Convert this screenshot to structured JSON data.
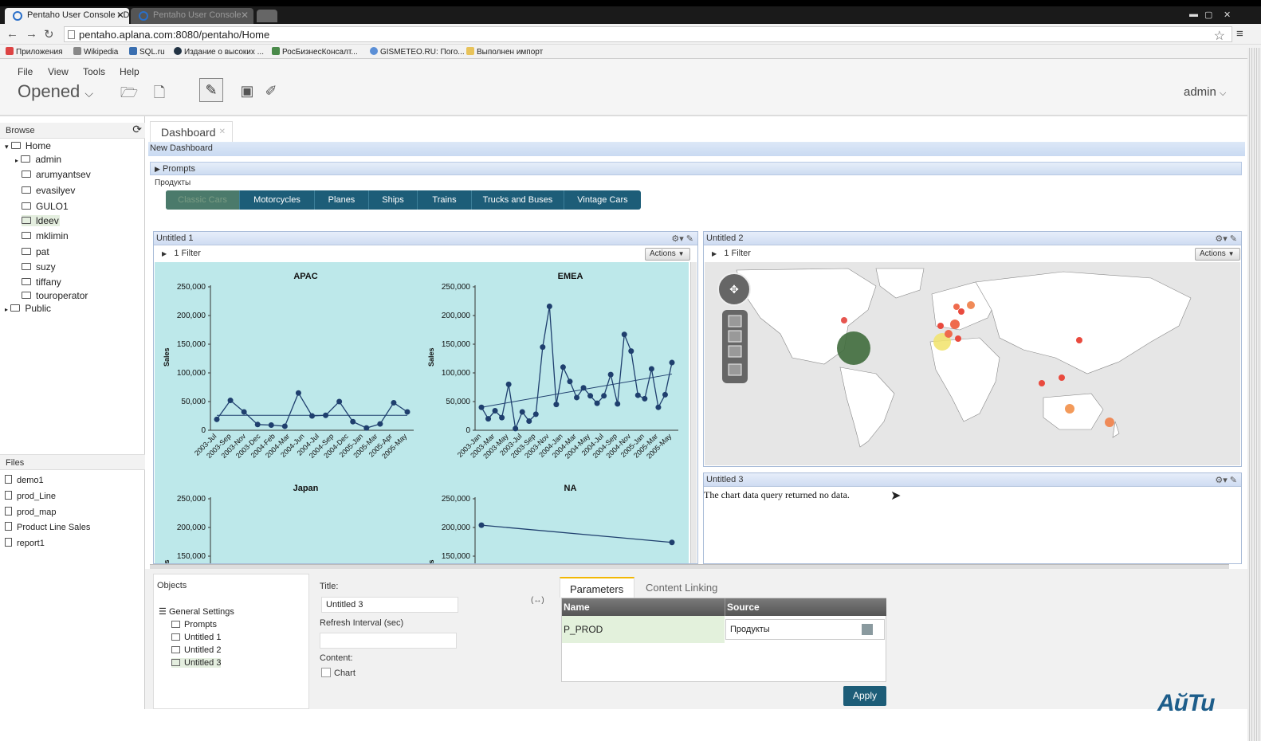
{
  "browser": {
    "tabs": [
      "Pentaho User Console - D",
      "Pentaho User Console"
    ],
    "url": "pentaho.aplana.com:8080/pentaho/Home",
    "bookmarks": [
      "Приложения",
      "Wikipedia",
      "SQL.ru",
      "Издание о высоких ...",
      "РосБизнесКонсалт...",
      "GISMETEO.RU: Пого...",
      "Выполнен импорт"
    ]
  },
  "app": {
    "menu": [
      "File",
      "View",
      "Tools",
      "Help"
    ],
    "perspective": "Opened",
    "user": "admin"
  },
  "browse": {
    "title": "Browse",
    "tree": [
      {
        "label": "Home"
      },
      {
        "label": "admin"
      },
      {
        "label": "arumyantsev"
      },
      {
        "label": "evasilyev"
      },
      {
        "label": "GULO1"
      },
      {
        "label": "ldeev"
      },
      {
        "label": "mklimin"
      },
      {
        "label": "pat"
      },
      {
        "label": "suzy"
      },
      {
        "label": "tiffany"
      },
      {
        "label": "touroperator"
      },
      {
        "label": "Public"
      }
    ]
  },
  "files": {
    "title": "Files",
    "items": [
      "demo1",
      "prod_Line",
      "prod_map",
      "Product Line Sales",
      "report1"
    ]
  },
  "dashboard": {
    "tab": "Dashboard",
    "name": "New Dashboard",
    "prompts_label": "Prompts",
    "prompt_name": "Продукты",
    "products": [
      "Classic Cars",
      "Motorcycles",
      "Planes",
      "Ships",
      "Trains",
      "Trucks and Buses",
      "Vintage Cars"
    ],
    "panel1": {
      "title": "Untitled 1",
      "filter": "1 Filter",
      "actions": "Actions"
    },
    "panel2": {
      "title": "Untitled 2",
      "filter": "1 Filter",
      "actions": "Actions"
    },
    "panel3": {
      "title": "Untitled 3",
      "message": "The chart data query returned no data."
    }
  },
  "editor": {
    "objects_title": "Objects",
    "objects": [
      "General Settings",
      "Prompts",
      "Untitled 1",
      "Untitled 2",
      "Untitled 3"
    ],
    "title_label": "Title:",
    "title_value": "Untitled 3",
    "refresh_label": "Refresh Interval (sec)",
    "refresh_value": "",
    "content_label": "Content:",
    "content_option": "Chart",
    "tabs": [
      "Parameters",
      "Content Linking"
    ],
    "table_headers": [
      "Name",
      "Source"
    ],
    "param_name": "P_PROD",
    "param_source": "Продукты",
    "apply": "Apply"
  },
  "brand_logo": "АйТи",
  "chart_data": [
    {
      "type": "line",
      "title": "APAC",
      "ylabel": "Sales",
      "ylim": [
        0,
        250000
      ],
      "y_ticks": [
        "250,000",
        "200,000",
        "150,000",
        "100,000",
        "50,000",
        "0"
      ],
      "x_labels": [
        "2003-Jul",
        "2003-Sep",
        "2003-Nov",
        "2003-Dec",
        "2004-Feb",
        "2004-Mar",
        "2004-Jun",
        "2004-Jul",
        "2004-Sep",
        "2004-Dec",
        "2005-Jan",
        "2005-Mar",
        "2005-Apr",
        "2005-May"
      ],
      "values": [
        19000,
        52000,
        32000,
        10000,
        9000,
        7000,
        65000,
        25000,
        26000,
        50000,
        15000,
        4000,
        11000,
        48000,
        32000
      ],
      "trend": [
        26000,
        26000
      ]
    },
    {
      "type": "line",
      "title": "EMEA",
      "ylabel": "Sales",
      "ylim": [
        0,
        250000
      ],
      "y_ticks": [
        "250,000",
        "200,000",
        "150,000",
        "100,000",
        "50,000",
        "0"
      ],
      "x_labels": [
        "2003-Jan",
        "2003-Mar",
        "2003-May",
        "2003-Jul",
        "2003-Sep",
        "2003-Nov",
        "2004-Jan",
        "2004-Mar",
        "2004-May",
        "2004-Jul",
        "2004-Sep",
        "2004-Nov",
        "2005-Jan",
        "2005-Mar",
        "2005-May"
      ],
      "values": [
        40000,
        20000,
        34000,
        22000,
        80000,
        3000,
        32000,
        16000,
        28000,
        145000,
        216000,
        45000,
        110000,
        85000,
        57000,
        74000,
        60000,
        47000,
        60000,
        97000,
        46000,
        167000,
        138000,
        61000,
        55000,
        107000,
        40000,
        62000,
        118000
      ],
      "trend": [
        40000,
        98000
      ]
    },
    {
      "type": "line",
      "title": "Japan",
      "ylabel": "Sales",
      "ylim": [
        0,
        250000
      ],
      "y_ticks": [
        "250,000",
        "200,000",
        "150,000"
      ],
      "values": []
    },
    {
      "type": "line",
      "title": "NA",
      "ylabel": "Sales",
      "ylim": [
        0,
        250000
      ],
      "y_ticks": [
        "250,000",
        "200,000",
        "150,000"
      ],
      "values": [
        204000,
        174000
      ]
    }
  ]
}
